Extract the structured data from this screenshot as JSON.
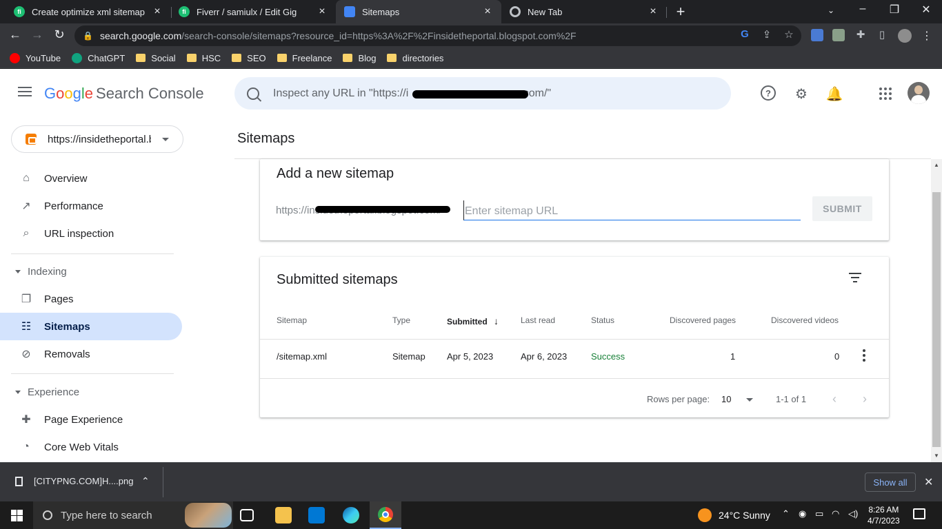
{
  "browser": {
    "tabs": [
      {
        "title": "Create optimize xml sitemap and",
        "favicon": "fiverr-icon",
        "color": "#1dbf73",
        "glyph": "fi"
      },
      {
        "title": "Fiverr / samiulx / Edit Gig",
        "favicon": "fiverr-icon",
        "color": "#1dbf73",
        "glyph": "fi"
      },
      {
        "title": "Sitemaps",
        "favicon": "search-console-icon",
        "color": "#4285f4",
        "glyph": ""
      },
      {
        "title": "New Tab",
        "favicon": "chrome-icon",
        "color": "#bdc1c6",
        "glyph": ""
      }
    ],
    "address": {
      "host": "search.google.com",
      "path": "/search-console/sitemaps?resource_id=https%3A%2F%2Finsidetheportal.blogspot.com%2F"
    },
    "bookmarks": [
      {
        "label": "YouTube",
        "icon": "youtube-icon"
      },
      {
        "label": "ChatGPT",
        "icon": "chatgpt-icon"
      },
      {
        "label": "Social",
        "icon": "folder-icon"
      },
      {
        "label": "HSC",
        "icon": "folder-icon"
      },
      {
        "label": "SEO",
        "icon": "folder-icon"
      },
      {
        "label": "Freelance",
        "icon": "folder-icon"
      },
      {
        "label": "Blog",
        "icon": "folder-icon"
      },
      {
        "label": "directories",
        "icon": "folder-icon"
      }
    ]
  },
  "app": {
    "logo_letters": [
      "G",
      "o",
      "o",
      "g",
      "l",
      "e"
    ],
    "product": "Search Console",
    "search_placeholder": "Inspect any URL in \"https://i",
    "search_placeholder_end": ".com/\"",
    "property": "https://insidetheportal.blogspot.com/"
  },
  "sidebar": {
    "items_top": [
      {
        "label": "Overview",
        "icon": "home-icon"
      },
      {
        "label": "Performance",
        "icon": "trending-up-icon"
      },
      {
        "label": "URL inspection",
        "icon": "search-icon"
      }
    ],
    "section_indexing": "Indexing",
    "items_indexing": [
      {
        "label": "Pages",
        "icon": "pages-icon"
      },
      {
        "label": "Sitemaps",
        "icon": "sitemap-icon",
        "active": true
      },
      {
        "label": "Removals",
        "icon": "eye-off-icon"
      }
    ],
    "section_experience": "Experience",
    "items_experience": [
      {
        "label": "Page Experience",
        "icon": "page-experience-icon"
      },
      {
        "label": "Core Web Vitals",
        "icon": "speedometer-icon"
      }
    ]
  },
  "main": {
    "page_title": "Sitemaps",
    "add_card": {
      "title": "Add a new sitemap",
      "prefix": "https://insidetheportal.blogspot.com/",
      "input_placeholder": "Enter sitemap URL",
      "submit_label": "SUBMIT"
    },
    "submitted_card": {
      "title": "Submitted sitemaps",
      "columns": [
        "Sitemap",
        "Type",
        "Submitted",
        "Last read",
        "Status",
        "Discovered pages",
        "Discovered videos"
      ],
      "rows": [
        {
          "sitemap": "/sitemap.xml",
          "type": "Sitemap",
          "submitted": "Apr 5, 2023",
          "last_read": "Apr 6, 2023",
          "status": "Success",
          "discovered_pages": "1",
          "discovered_videos": "0"
        }
      ],
      "rows_per_page_label": "Rows per page:",
      "rows_per_page_value": "10",
      "range": "1-1 of 1"
    }
  },
  "downloads": {
    "file": "[CITYPNG.COM]H....png",
    "show_all": "Show all"
  },
  "taskbar": {
    "search_placeholder": "Type here to search",
    "weather": "24°C  Sunny",
    "time": "8:26 AM",
    "date": "4/7/2023"
  },
  "colors": {
    "accent": "#1a73e8",
    "nav_active": "#d3e3fd",
    "success": "#188038"
  }
}
